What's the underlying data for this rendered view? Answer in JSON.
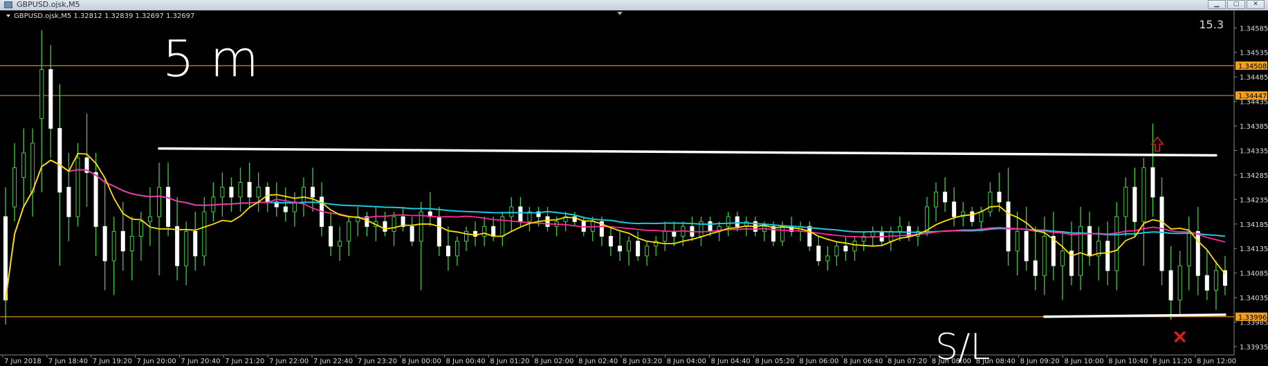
{
  "window": {
    "title": "GBPUSD.ojsk,M5"
  },
  "chart_data": {
    "type": "candlestick",
    "symbol_header": "GBPUSD.ojsk,M5  1.32812 1.32839 1.32697 1.32697",
    "corner_value": "15.3",
    "ylim": [
      1.33935,
      1.34615
    ],
    "price_ticks": [
      "1.34585",
      "1.34535",
      "1.34485",
      "1.34435",
      "1.34385",
      "1.34335",
      "1.34285",
      "1.34235",
      "1.34185",
      "1.34135",
      "1.34085",
      "1.34035",
      "1.33985",
      "1.33935"
    ],
    "time_ticks": [
      "7 Jun 2018",
      "7 Jun 18:40",
      "7 Jun 19:20",
      "7 Jun 20:00",
      "7 Jun 20:40",
      "7 Jun 21:20",
      "7 Jun 22:00",
      "7 Jun 22:40",
      "7 Jun 23:20",
      "8 Jun 00:00",
      "8 Jun 00:40",
      "8 Jun 01:20",
      "8 Jun 02:00",
      "8 Jun 02:40",
      "8 Jun 03:20",
      "8 Jun 04:00",
      "8 Jun 04:40",
      "8 Jun 05:20",
      "8 Jun 06:00",
      "8 Jun 06:40",
      "8 Jun 07:20",
      "8 Jun 08:00",
      "8 Jun 08:40",
      "8 Jun 09:20",
      "8 Jun 10:00",
      "8 Jun 10:40",
      "8 Jun 11:20",
      "8 Jun 12:00"
    ],
    "horizontal_levels": [
      {
        "price": 1.34508,
        "label": "1.34508",
        "color": "#d98a1a"
      },
      {
        "price": 1.34447,
        "label": "1.34447",
        "color": "#d98a1a"
      },
      {
        "price": 1.33996,
        "label": "1.33996",
        "color": "#d98a1a"
      }
    ],
    "drawn_lines": [
      {
        "t0": 34,
        "p0": 1.34339,
        "t1": 268,
        "p1": 1.34325,
        "color": "#ffffff"
      },
      {
        "t0": 230,
        "p0": 1.33996,
        "t1": 270,
        "p1": 1.34,
        "color": "#ffffff"
      }
    ],
    "handwritten_labels": [
      "5 m",
      "S/L"
    ],
    "markers": [
      {
        "type": "up-arrow",
        "t": 255,
        "price": 1.34345,
        "color": "#e0201c"
      },
      {
        "type": "cross",
        "t": 260,
        "price": 1.33955,
        "color": "#e0201c"
      }
    ],
    "colors": {
      "background": "#000000",
      "bull": "#ffffff",
      "bear": "#ffffff",
      "wick": "#3fcf3f",
      "ma_fast": "#ffe000",
      "ma_mid": "#ff2aa0",
      "ma_slow": "#1ec8e0"
    },
    "bars": [
      {
        "t": 0,
        "o": 1.342,
        "h": 1.3426,
        "l": 1.3398,
        "c": 1.3403
      },
      {
        "t": 2,
        "o": 1.3422,
        "h": 1.3435,
        "l": 1.3419,
        "c": 1.343
      },
      {
        "t": 4,
        "o": 1.3428,
        "h": 1.3438,
        "l": 1.3422,
        "c": 1.3433
      },
      {
        "t": 6,
        "o": 1.3425,
        "h": 1.3438,
        "l": 1.342,
        "c": 1.3435
      },
      {
        "t": 8,
        "o": 1.344,
        "h": 1.3458,
        "l": 1.3425,
        "c": 1.345
      },
      {
        "t": 10,
        "o": 1.345,
        "h": 1.3455,
        "l": 1.3432,
        "c": 1.3438
      },
      {
        "t": 12,
        "o": 1.3438,
        "h": 1.3447,
        "l": 1.341,
        "c": 1.3425
      },
      {
        "t": 14,
        "o": 1.3426,
        "h": 1.3433,
        "l": 1.3415,
        "c": 1.342
      },
      {
        "t": 16,
        "o": 1.342,
        "h": 1.3435,
        "l": 1.3418,
        "c": 1.3432
      },
      {
        "t": 18,
        "o": 1.3432,
        "h": 1.3441,
        "l": 1.3422,
        "c": 1.3429
      },
      {
        "t": 20,
        "o": 1.3429,
        "h": 1.3433,
        "l": 1.3412,
        "c": 1.3418
      },
      {
        "t": 22,
        "o": 1.3418,
        "h": 1.3428,
        "l": 1.3405,
        "c": 1.3411
      },
      {
        "t": 24,
        "o": 1.3411,
        "h": 1.342,
        "l": 1.3404,
        "c": 1.3417
      },
      {
        "t": 26,
        "o": 1.3417,
        "h": 1.3423,
        "l": 1.3409,
        "c": 1.3413
      },
      {
        "t": 28,
        "o": 1.3413,
        "h": 1.342,
        "l": 1.3407,
        "c": 1.3416
      },
      {
        "t": 30,
        "o": 1.3416,
        "h": 1.3421,
        "l": 1.3411,
        "c": 1.3419
      },
      {
        "t": 32,
        "o": 1.3419,
        "h": 1.3426,
        "l": 1.3414,
        "c": 1.342
      },
      {
        "t": 34,
        "o": 1.342,
        "h": 1.3431,
        "l": 1.3408,
        "c": 1.3426
      },
      {
        "t": 36,
        "o": 1.3426,
        "h": 1.3431,
        "l": 1.3416,
        "c": 1.3418
      },
      {
        "t": 38,
        "o": 1.3418,
        "h": 1.3424,
        "l": 1.3407,
        "c": 1.341
      },
      {
        "t": 40,
        "o": 1.341,
        "h": 1.3419,
        "l": 1.3406,
        "c": 1.3417
      },
      {
        "t": 42,
        "o": 1.3417,
        "h": 1.3421,
        "l": 1.3409,
        "c": 1.3412
      },
      {
        "t": 44,
        "o": 1.3412,
        "h": 1.3424,
        "l": 1.341,
        "c": 1.3421
      },
      {
        "t": 46,
        "o": 1.3421,
        "h": 1.3427,
        "l": 1.3419,
        "c": 1.3424
      },
      {
        "t": 48,
        "o": 1.3424,
        "h": 1.3429,
        "l": 1.342,
        "c": 1.3426
      },
      {
        "t": 50,
        "o": 1.3426,
        "h": 1.3428,
        "l": 1.3421,
        "c": 1.3424
      },
      {
        "t": 52,
        "o": 1.3424,
        "h": 1.343,
        "l": 1.3421,
        "c": 1.3427
      },
      {
        "t": 54,
        "o": 1.3427,
        "h": 1.3431,
        "l": 1.3422,
        "c": 1.3424
      },
      {
        "t": 56,
        "o": 1.3424,
        "h": 1.3429,
        "l": 1.3421,
        "c": 1.3426
      },
      {
        "t": 58,
        "o": 1.3426,
        "h": 1.3427,
        "l": 1.3421,
        "c": 1.3423
      },
      {
        "t": 60,
        "o": 1.3423,
        "h": 1.3427,
        "l": 1.342,
        "c": 1.3422
      },
      {
        "t": 62,
        "o": 1.3422,
        "h": 1.3426,
        "l": 1.3419,
        "c": 1.3421
      },
      {
        "t": 64,
        "o": 1.3421,
        "h": 1.3425,
        "l": 1.3418,
        "c": 1.3423
      },
      {
        "t": 66,
        "o": 1.3423,
        "h": 1.3428,
        "l": 1.342,
        "c": 1.3426
      },
      {
        "t": 68,
        "o": 1.3426,
        "h": 1.343,
        "l": 1.3421,
        "c": 1.3424
      },
      {
        "t": 70,
        "o": 1.3424,
        "h": 1.3427,
        "l": 1.3416,
        "c": 1.3418
      },
      {
        "t": 72,
        "o": 1.3418,
        "h": 1.3421,
        "l": 1.3412,
        "c": 1.3414
      },
      {
        "t": 74,
        "o": 1.3414,
        "h": 1.3418,
        "l": 1.3411,
        "c": 1.3415
      },
      {
        "t": 76,
        "o": 1.3415,
        "h": 1.342,
        "l": 1.3412,
        "c": 1.3419
      },
      {
        "t": 78,
        "o": 1.3419,
        "h": 1.3422,
        "l": 1.3416,
        "c": 1.342
      },
      {
        "t": 80,
        "o": 1.342,
        "h": 1.3421,
        "l": 1.3416,
        "c": 1.3418
      },
      {
        "t": 82,
        "o": 1.3418,
        "h": 1.3422,
        "l": 1.3415,
        "c": 1.3419
      },
      {
        "t": 84,
        "o": 1.3419,
        "h": 1.3421,
        "l": 1.3416,
        "c": 1.3417
      },
      {
        "t": 86,
        "o": 1.3417,
        "h": 1.3421,
        "l": 1.3414,
        "c": 1.342
      },
      {
        "t": 88,
        "o": 1.342,
        "h": 1.3422,
        "l": 1.3417,
        "c": 1.3418
      },
      {
        "t": 90,
        "o": 1.3418,
        "h": 1.342,
        "l": 1.3414,
        "c": 1.3415
      },
      {
        "t": 92,
        "o": 1.3415,
        "h": 1.3423,
        "l": 1.3405,
        "c": 1.3421
      },
      {
        "t": 94,
        "o": 1.3421,
        "h": 1.3425,
        "l": 1.3418,
        "c": 1.342
      },
      {
        "t": 96,
        "o": 1.342,
        "h": 1.3422,
        "l": 1.3412,
        "c": 1.3414
      },
      {
        "t": 98,
        "o": 1.3414,
        "h": 1.3418,
        "l": 1.3409,
        "c": 1.3412
      },
      {
        "t": 100,
        "o": 1.3412,
        "h": 1.3416,
        "l": 1.341,
        "c": 1.3415
      },
      {
        "t": 102,
        "o": 1.3415,
        "h": 1.3418,
        "l": 1.3413,
        "c": 1.3417
      },
      {
        "t": 104,
        "o": 1.3417,
        "h": 1.3419,
        "l": 1.3414,
        "c": 1.3416
      },
      {
        "t": 106,
        "o": 1.3416,
        "h": 1.342,
        "l": 1.3414,
        "c": 1.3418
      },
      {
        "t": 108,
        "o": 1.3418,
        "h": 1.342,
        "l": 1.3415,
        "c": 1.3416
      },
      {
        "t": 110,
        "o": 1.3416,
        "h": 1.3421,
        "l": 1.3414,
        "c": 1.342
      },
      {
        "t": 112,
        "o": 1.342,
        "h": 1.3424,
        "l": 1.3417,
        "c": 1.3422
      },
      {
        "t": 114,
        "o": 1.3422,
        "h": 1.3424,
        "l": 1.3418,
        "c": 1.3419
      },
      {
        "t": 116,
        "o": 1.3419,
        "h": 1.3422,
        "l": 1.3417,
        "c": 1.3421
      },
      {
        "t": 118,
        "o": 1.3421,
        "h": 1.3422,
        "l": 1.3418,
        "c": 1.342
      },
      {
        "t": 120,
        "o": 1.342,
        "h": 1.3422,
        "l": 1.3417,
        "c": 1.3418
      },
      {
        "t": 122,
        "o": 1.3418,
        "h": 1.342,
        "l": 1.3416,
        "c": 1.3419
      },
      {
        "t": 124,
        "o": 1.3419,
        "h": 1.3421,
        "l": 1.3417,
        "c": 1.342
      },
      {
        "t": 126,
        "o": 1.342,
        "h": 1.3421,
        "l": 1.3418,
        "c": 1.3419
      },
      {
        "t": 128,
        "o": 1.3419,
        "h": 1.342,
        "l": 1.3416,
        "c": 1.3417
      },
      {
        "t": 130,
        "o": 1.3417,
        "h": 1.342,
        "l": 1.3415,
        "c": 1.3419
      },
      {
        "t": 132,
        "o": 1.3419,
        "h": 1.342,
        "l": 1.3414,
        "c": 1.3416
      },
      {
        "t": 134,
        "o": 1.3416,
        "h": 1.3418,
        "l": 1.3412,
        "c": 1.3414
      },
      {
        "t": 136,
        "o": 1.3414,
        "h": 1.3417,
        "l": 1.3411,
        "c": 1.3413
      },
      {
        "t": 138,
        "o": 1.3413,
        "h": 1.3416,
        "l": 1.341,
        "c": 1.3415
      },
      {
        "t": 140,
        "o": 1.3415,
        "h": 1.3417,
        "l": 1.3411,
        "c": 1.3412
      },
      {
        "t": 142,
        "o": 1.3412,
        "h": 1.3415,
        "l": 1.341,
        "c": 1.3414
      },
      {
        "t": 144,
        "o": 1.3414,
        "h": 1.3416,
        "l": 1.3412,
        "c": 1.3415
      },
      {
        "t": 146,
        "o": 1.3415,
        "h": 1.3419,
        "l": 1.3413,
        "c": 1.3417
      },
      {
        "t": 148,
        "o": 1.3417,
        "h": 1.3419,
        "l": 1.3414,
        "c": 1.3416
      },
      {
        "t": 150,
        "o": 1.3416,
        "h": 1.3419,
        "l": 1.3414,
        "c": 1.3418
      },
      {
        "t": 152,
        "o": 1.3418,
        "h": 1.342,
        "l": 1.3415,
        "c": 1.3416
      },
      {
        "t": 154,
        "o": 1.3416,
        "h": 1.342,
        "l": 1.3414,
        "c": 1.3419
      },
      {
        "t": 156,
        "o": 1.3419,
        "h": 1.342,
        "l": 1.3416,
        "c": 1.3417
      },
      {
        "t": 158,
        "o": 1.3417,
        "h": 1.3419,
        "l": 1.3415,
        "c": 1.3418
      },
      {
        "t": 160,
        "o": 1.3418,
        "h": 1.3421,
        "l": 1.3416,
        "c": 1.342
      },
      {
        "t": 162,
        "o": 1.342,
        "h": 1.3421,
        "l": 1.3417,
        "c": 1.3418
      },
      {
        "t": 164,
        "o": 1.3418,
        "h": 1.342,
        "l": 1.3416,
        "c": 1.3419
      },
      {
        "t": 166,
        "o": 1.3419,
        "h": 1.342,
        "l": 1.3416,
        "c": 1.3417
      },
      {
        "t": 168,
        "o": 1.3417,
        "h": 1.3419,
        "l": 1.3415,
        "c": 1.3418
      },
      {
        "t": 170,
        "o": 1.3418,
        "h": 1.3419,
        "l": 1.3414,
        "c": 1.3415
      },
      {
        "t": 172,
        "o": 1.3415,
        "h": 1.3419,
        "l": 1.3414,
        "c": 1.3418
      },
      {
        "t": 174,
        "o": 1.3418,
        "h": 1.342,
        "l": 1.3416,
        "c": 1.3417
      },
      {
        "t": 176,
        "o": 1.3417,
        "h": 1.3419,
        "l": 1.3415,
        "c": 1.3418
      },
      {
        "t": 178,
        "o": 1.3418,
        "h": 1.3419,
        "l": 1.3413,
        "c": 1.3414
      },
      {
        "t": 180,
        "o": 1.3414,
        "h": 1.3416,
        "l": 1.341,
        "c": 1.3411
      },
      {
        "t": 182,
        "o": 1.3411,
        "h": 1.3414,
        "l": 1.3409,
        "c": 1.3412
      },
      {
        "t": 184,
        "o": 1.3412,
        "h": 1.3415,
        "l": 1.341,
        "c": 1.3414
      },
      {
        "t": 186,
        "o": 1.3414,
        "h": 1.3416,
        "l": 1.3411,
        "c": 1.3413
      },
      {
        "t": 188,
        "o": 1.3413,
        "h": 1.3416,
        "l": 1.3411,
        "c": 1.3415
      },
      {
        "t": 190,
        "o": 1.3415,
        "h": 1.3417,
        "l": 1.3413,
        "c": 1.3416
      },
      {
        "t": 192,
        "o": 1.3416,
        "h": 1.3418,
        "l": 1.3414,
        "c": 1.3417
      },
      {
        "t": 194,
        "o": 1.3417,
        "h": 1.3418,
        "l": 1.3414,
        "c": 1.3415
      },
      {
        "t": 196,
        "o": 1.3415,
        "h": 1.3418,
        "l": 1.3413,
        "c": 1.3417
      },
      {
        "t": 198,
        "o": 1.3417,
        "h": 1.342,
        "l": 1.3415,
        "c": 1.3418
      },
      {
        "t": 200,
        "o": 1.3418,
        "h": 1.3419,
        "l": 1.3415,
        "c": 1.3416
      },
      {
        "t": 202,
        "o": 1.3416,
        "h": 1.3418,
        "l": 1.3414,
        "c": 1.3417
      },
      {
        "t": 204,
        "o": 1.3417,
        "h": 1.3424,
        "l": 1.3416,
        "c": 1.3422
      },
      {
        "t": 206,
        "o": 1.3422,
        "h": 1.3427,
        "l": 1.3419,
        "c": 1.3425
      },
      {
        "t": 208,
        "o": 1.3425,
        "h": 1.3428,
        "l": 1.3421,
        "c": 1.3423
      },
      {
        "t": 210,
        "o": 1.3423,
        "h": 1.3426,
        "l": 1.3418,
        "c": 1.342
      },
      {
        "t": 212,
        "o": 1.342,
        "h": 1.3423,
        "l": 1.3418,
        "c": 1.3421
      },
      {
        "t": 214,
        "o": 1.3421,
        "h": 1.3422,
        "l": 1.3418,
        "c": 1.3419
      },
      {
        "t": 216,
        "o": 1.3419,
        "h": 1.3422,
        "l": 1.3417,
        "c": 1.3421
      },
      {
        "t": 218,
        "o": 1.3421,
        "h": 1.3427,
        "l": 1.342,
        "c": 1.3425
      },
      {
        "t": 220,
        "o": 1.3425,
        "h": 1.3429,
        "l": 1.3421,
        "c": 1.3423
      },
      {
        "t": 222,
        "o": 1.3423,
        "h": 1.343,
        "l": 1.341,
        "c": 1.3413
      },
      {
        "t": 224,
        "o": 1.3413,
        "h": 1.3421,
        "l": 1.3408,
        "c": 1.3417
      },
      {
        "t": 226,
        "o": 1.3417,
        "h": 1.3422,
        "l": 1.3409,
        "c": 1.3411
      },
      {
        "t": 228,
        "o": 1.3411,
        "h": 1.3418,
        "l": 1.3405,
        "c": 1.3408
      },
      {
        "t": 230,
        "o": 1.3408,
        "h": 1.342,
        "l": 1.3404,
        "c": 1.3416
      },
      {
        "t": 232,
        "o": 1.3416,
        "h": 1.3421,
        "l": 1.3407,
        "c": 1.341
      },
      {
        "t": 234,
        "o": 1.341,
        "h": 1.3417,
        "l": 1.3403,
        "c": 1.3413
      },
      {
        "t": 236,
        "o": 1.3413,
        "h": 1.3419,
        "l": 1.3406,
        "c": 1.3408
      },
      {
        "t": 238,
        "o": 1.3408,
        "h": 1.3422,
        "l": 1.3405,
        "c": 1.3418
      },
      {
        "t": 240,
        "o": 1.3418,
        "h": 1.3421,
        "l": 1.341,
        "c": 1.3412
      },
      {
        "t": 242,
        "o": 1.3412,
        "h": 1.3418,
        "l": 1.3407,
        "c": 1.3415
      },
      {
        "t": 244,
        "o": 1.3415,
        "h": 1.3419,
        "l": 1.3406,
        "c": 1.3409
      },
      {
        "t": 246,
        "o": 1.3409,
        "h": 1.3423,
        "l": 1.3405,
        "c": 1.342
      },
      {
        "t": 248,
        "o": 1.342,
        "h": 1.3428,
        "l": 1.3416,
        "c": 1.3426
      },
      {
        "t": 250,
        "o": 1.3426,
        "h": 1.343,
        "l": 1.3416,
        "c": 1.3419
      },
      {
        "t": 252,
        "o": 1.3419,
        "h": 1.3432,
        "l": 1.341,
        "c": 1.343
      },
      {
        "t": 254,
        "o": 1.343,
        "h": 1.3439,
        "l": 1.342,
        "c": 1.3424
      },
      {
        "t": 256,
        "o": 1.3424,
        "h": 1.3428,
        "l": 1.3406,
        "c": 1.3409
      },
      {
        "t": 258,
        "o": 1.3409,
        "h": 1.3414,
        "l": 1.3399,
        "c": 1.3403
      },
      {
        "t": 260,
        "o": 1.3403,
        "h": 1.3413,
        "l": 1.34,
        "c": 1.341
      },
      {
        "t": 262,
        "o": 1.341,
        "h": 1.342,
        "l": 1.3405,
        "c": 1.3417
      },
      {
        "t": 264,
        "o": 1.3417,
        "h": 1.3422,
        "l": 1.3404,
        "c": 1.3408
      },
      {
        "t": 266,
        "o": 1.3408,
        "h": 1.3413,
        "l": 1.3403,
        "c": 1.3405
      },
      {
        "t": 268,
        "o": 1.3405,
        "h": 1.3411,
        "l": 1.3401,
        "c": 1.3409
      },
      {
        "t": 270,
        "o": 1.3409,
        "h": 1.3412,
        "l": 1.3404,
        "c": 1.3406
      }
    ]
  }
}
